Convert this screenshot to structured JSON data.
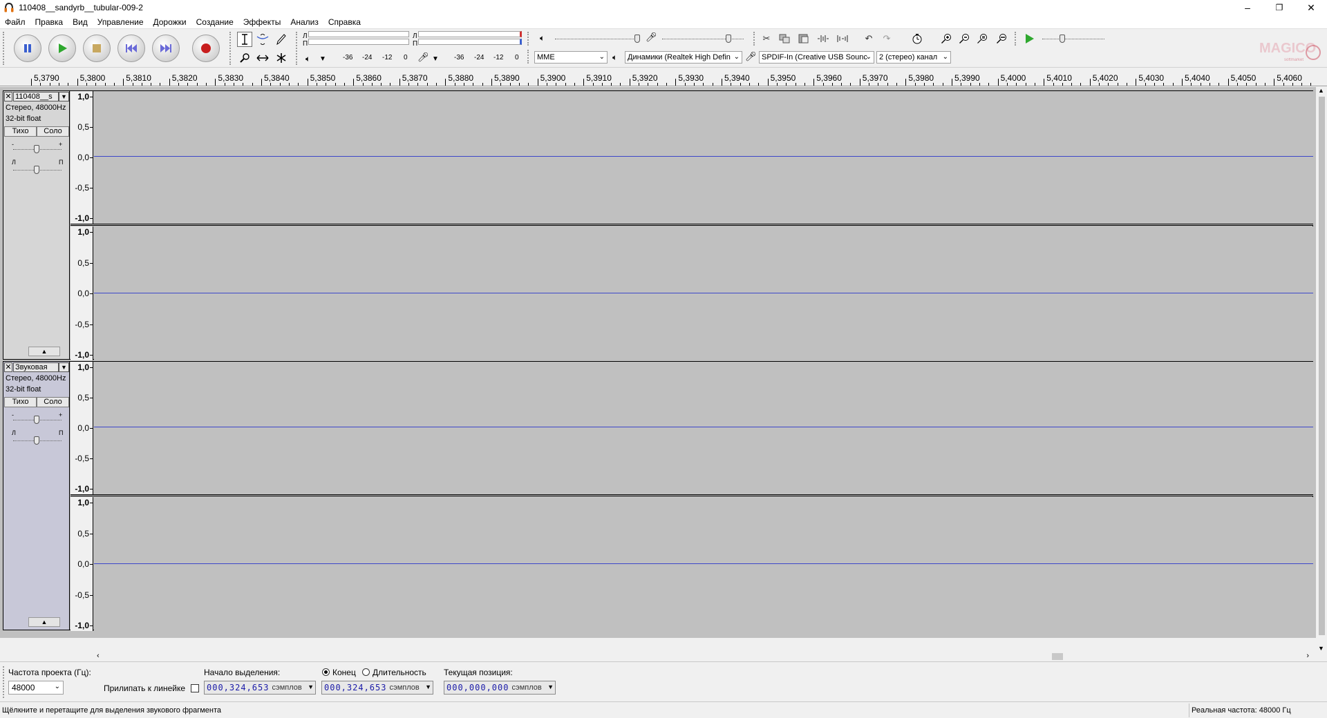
{
  "window": {
    "title": "110408__sandyrb__tubular-009-2",
    "minimize": "–",
    "maximize": "❐",
    "close": "✕"
  },
  "menu": [
    "Файл",
    "Правка",
    "Вид",
    "Управление",
    "Дорожки",
    "Создание",
    "Эффекты",
    "Анализ",
    "Справка"
  ],
  "meters": {
    "channel_left": "Л",
    "channel_right": "П",
    "scale_play": [
      "-36",
      "-24",
      "-12",
      "0"
    ],
    "scale_rec": [
      "-36",
      "-24",
      "-12",
      "0"
    ]
  },
  "device": {
    "host": "MME",
    "playback": "Динамики (Realtek High Defin",
    "recording": "SPDIF-In (Creative USB Sounc",
    "channels": "2 (стерео) канал"
  },
  "ruler": [
    "5,3790",
    "5,3800",
    "5,3810",
    "5,3820",
    "5,3830",
    "5,3840",
    "5,3850",
    "5,3860",
    "5,3870",
    "5,3880",
    "5,3890",
    "5,3900",
    "5,3910",
    "5,3920",
    "5,3930",
    "5,3940",
    "5,3950",
    "5,3960",
    "5,3970",
    "5,3980",
    "5,3990",
    "5,4000",
    "5,4010",
    "5,4020",
    "5,4030",
    "5,4040",
    "5,4050",
    "5,4060"
  ],
  "vruler": [
    "1,0",
    "0,5",
    "0,0",
    "-0,5",
    "-1,0"
  ],
  "tracks": [
    {
      "name": "110408__s",
      "format": "Стерео, 48000Hz",
      "bits": "32-bit float",
      "mute": "Тихо",
      "solo": "Соло",
      "gain_minus": "-",
      "gain_plus": "+",
      "pan_left": "Л",
      "pan_right": "П",
      "collapse": "▲"
    },
    {
      "name": "Звуковая",
      "format": "Стерео, 48000Hz",
      "bits": "32-bit float",
      "mute": "Тихо",
      "solo": "Соло",
      "gain_minus": "-",
      "gain_plus": "+",
      "pan_left": "Л",
      "pan_right": "П",
      "collapse": "▲"
    }
  ],
  "selection": {
    "rate_label": "Частота проекта (Гц):",
    "rate_value": "48000",
    "snap_label": "Прилипать к линейке",
    "start_label": "Начало выделения:",
    "start_value": "000,324,653",
    "end_label": "Конец",
    "length_label": "Длительность",
    "end_value": "000,324,653",
    "position_label": "Текущая позиция:",
    "position_value": "000,000,000",
    "unit": "сэмплов"
  },
  "status": {
    "hint": "Щёлкните и перетащите для выделения звукового фрагмента",
    "actual_rate": "Реальная частота: 48000 Гц"
  },
  "colors": {
    "waveform": "#3b46c9",
    "track_bg": "#c0c0c0",
    "play": "#2fa82f",
    "record": "#c81e1e",
    "timecode": "#1a1aa8"
  }
}
